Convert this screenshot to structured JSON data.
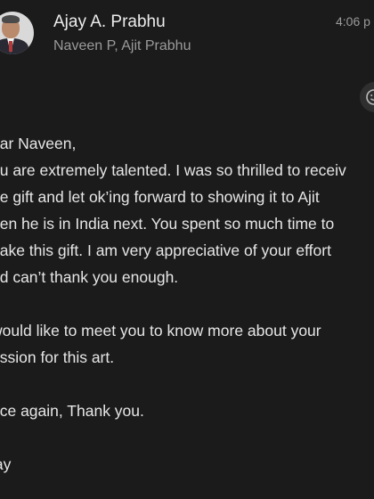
{
  "header": {
    "sender_name": "Ajay A. Prabhu",
    "recipients": "Naveen P, Ajit Prabhu",
    "time": "4:06 p"
  },
  "avatar_icon": "person-photo",
  "reaction_icon": "add-emoji-icon",
  "body": {
    "greeting": "ear Naveen,",
    "para1": [
      "ou are extremely talented. I was so thrilled to receiv",
      "he gift and let ok’ing forward to showing it to Ajit",
      "hen he is in India next. You spent so much time to",
      "nake this gift. I am very appreciative of your effort",
      "nd can’t thank you enough."
    ],
    "para2": [
      "would like to meet you to know more about your",
      "assion for this art."
    ],
    "closing": "nce again, Thank you.",
    "signature": "jay"
  },
  "colors": {
    "background": "#1b1b1b",
    "text": "#e6e6e6",
    "secondary_text": "#9a9a9a"
  }
}
